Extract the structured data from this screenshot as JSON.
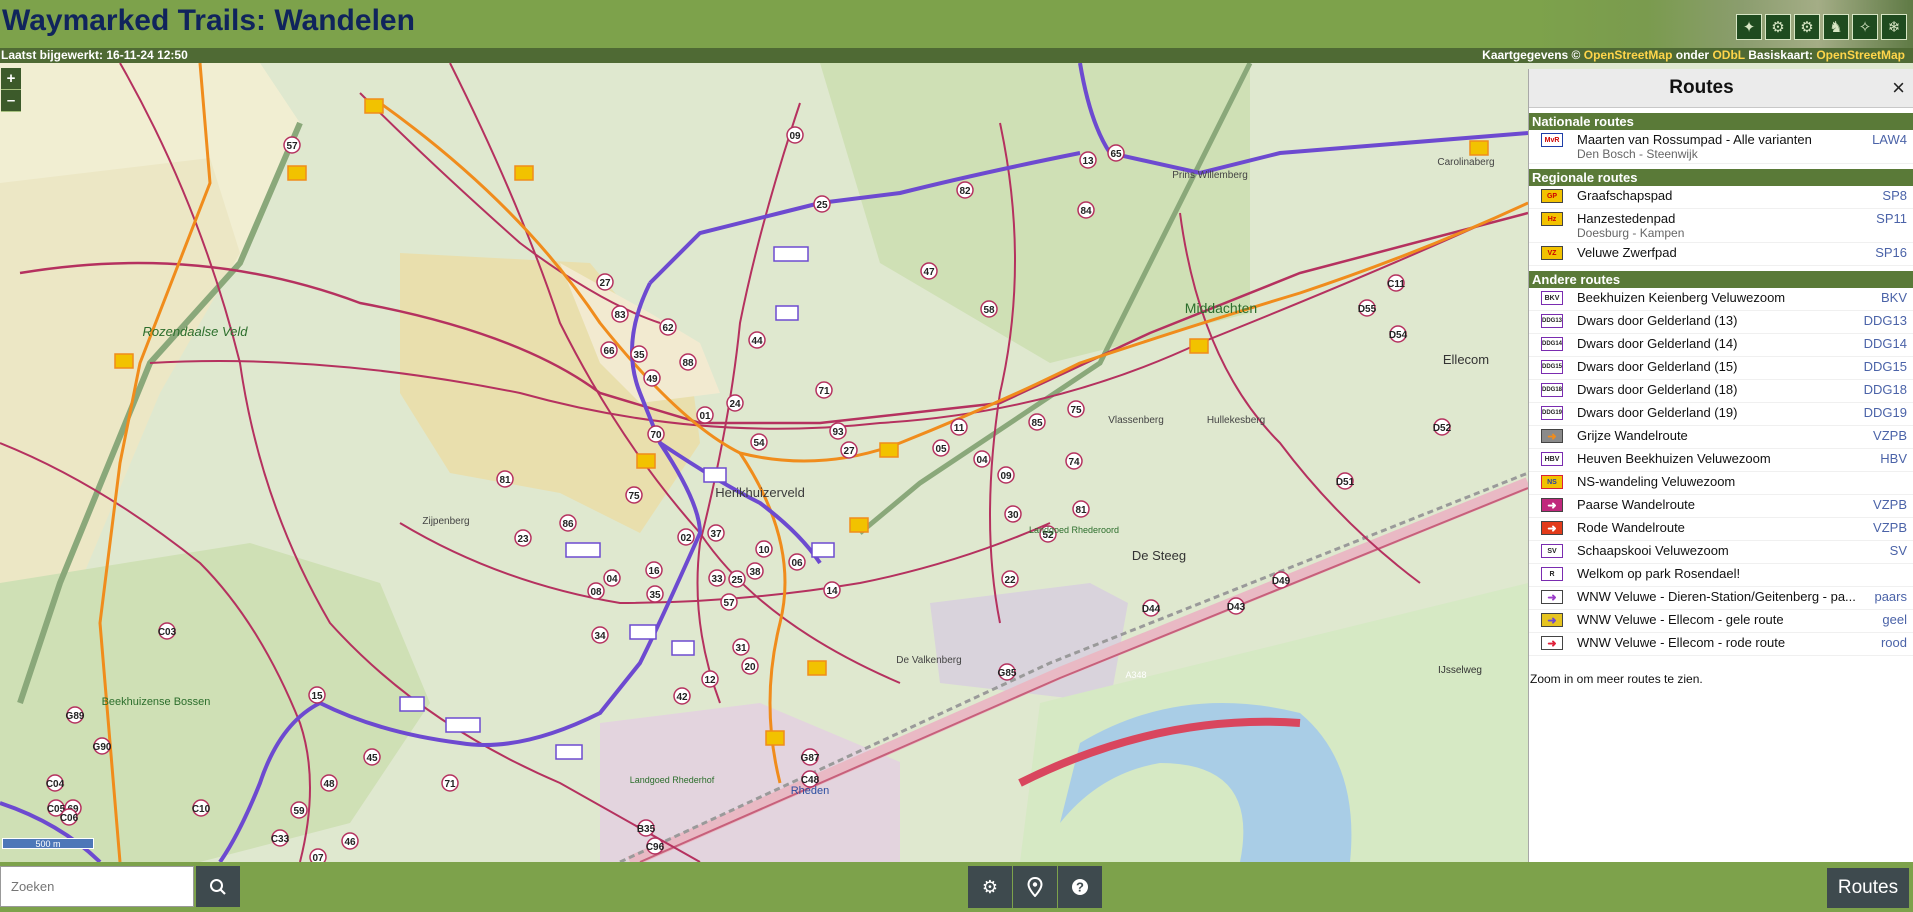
{
  "header": {
    "title": "Waymarked Trails: Wandelen",
    "theme_icons": [
      "hiking-icon",
      "cycling-icon",
      "mtb-icon",
      "riding-icon",
      "skating-icon",
      "slope-icon"
    ]
  },
  "subbar": {
    "last_updated": "Laatst bijgewerkt: 16-11-24 12:50",
    "attrib_prefix": "Kaartgegevens ©",
    "osm_link": "OpenStreetMap",
    "attrib_under": "onder",
    "odbl_link": "ODbL",
    "basemap_label": "Basiskaart:",
    "basemap_link": "OpenStreetMap"
  },
  "map": {
    "zoom_in": "+",
    "zoom_out": "–",
    "scale": "500 m",
    "place_labels": [
      {
        "name": "Rozendaalse Veld"
      },
      {
        "name": "Herikhuizerveld"
      },
      {
        "name": "Middachten"
      },
      {
        "name": "Ellecom"
      },
      {
        "name": "De Steeg"
      },
      {
        "name": "Rheden"
      },
      {
        "name": "Zijpenberg"
      },
      {
        "name": "Beekhuizense Bossen"
      },
      {
        "name": "Carolinaberg"
      },
      {
        "name": "Prins Willemberg"
      },
      {
        "name": "Vlassenberg"
      },
      {
        "name": "Hullekesberg"
      },
      {
        "name": "De Valkenberg"
      },
      {
        "name": "Landgoed Rhederoord"
      },
      {
        "name": "Landgoed Rhederhof"
      },
      {
        "name": "IJsselweg"
      },
      {
        "name": "A348"
      }
    ],
    "nodes": [
      "09",
      "65",
      "13",
      "84",
      "25",
      "82",
      "27",
      "83",
      "62",
      "66",
      "35",
      "49",
      "88",
      "44",
      "24",
      "01",
      "71",
      "47",
      "58",
      "70",
      "54",
      "93",
      "27",
      "05",
      "11",
      "85",
      "75",
      "81",
      "23",
      "86",
      "75",
      "02",
      "37",
      "16",
      "33",
      "25",
      "57",
      "38",
      "10",
      "06",
      "04",
      "35",
      "08",
      "34",
      "31",
      "20",
      "12",
      "42",
      "14",
      "81",
      "52",
      "22",
      "30",
      "09",
      "04",
      "74",
      "15",
      "45",
      "48",
      "71",
      "59",
      "46",
      "07",
      "57",
      "69",
      "G85",
      "G87",
      "C48",
      "B35",
      "C96",
      "C03",
      "C04",
      "C05",
      "C06",
      "C10",
      "C33",
      "G89",
      "G90",
      "D54",
      "D55",
      "D52",
      "D51",
      "D49",
      "D43",
      "D44",
      "C11"
    ]
  },
  "panel": {
    "title": "Routes",
    "close": "×",
    "sections": [
      {
        "heading": "Nationale routes",
        "routes": [
          {
            "symbol": "MvR",
            "name": "Maarten van Rossumpad - Alle varianten",
            "sub": "Den Bosch - Steenwijk",
            "code": "LAW4",
            "symbol_color": "#1f3ea8"
          }
        ]
      },
      {
        "heading": "Regionale routes",
        "routes": [
          {
            "symbol": "GP",
            "name": "Graafschapspad",
            "sub": "",
            "code": "SP8",
            "symbol_color": "#f2c200"
          },
          {
            "symbol": "Hz",
            "name": "Hanzestedenpad",
            "sub": "Doesburg - Kampen",
            "code": "SP11",
            "symbol_color": "#f2c200"
          },
          {
            "symbol": "VZ",
            "name": "Veluwe Zwerfpad",
            "sub": "",
            "code": "SP16",
            "symbol_color": "#f2c200"
          }
        ]
      },
      {
        "heading": "Andere routes",
        "routes": [
          {
            "symbol": "BKV",
            "name": "Beekhuizen Keienberg Veluwezoom",
            "sub": "",
            "code": "BKV",
            "symbol_color": "#7a2cb0"
          },
          {
            "symbol": "DDG13",
            "name": "Dwars door Gelderland (13)",
            "sub": "",
            "code": "DDG13",
            "symbol_color": "#7a2cb0"
          },
          {
            "symbol": "DDG14",
            "name": "Dwars door Gelderland (14)",
            "sub": "",
            "code": "DDG14",
            "symbol_color": "#7a2cb0"
          },
          {
            "symbol": "DDG15",
            "name": "Dwars door Gelderland (15)",
            "sub": "",
            "code": "DDG15",
            "symbol_color": "#7a2cb0"
          },
          {
            "symbol": "DDG18",
            "name": "Dwars door Gelderland (18)",
            "sub": "",
            "code": "DDG18",
            "symbol_color": "#7a2cb0"
          },
          {
            "symbol": "DDG19",
            "name": "Dwars door Gelderland (19)",
            "sub": "",
            "code": "DDG19",
            "symbol_color": "#7a2cb0"
          },
          {
            "symbol": "➜",
            "name": "Grijze Wandelroute",
            "sub": "",
            "code": "VZPB",
            "symbol_color": "#8a8a8a"
          },
          {
            "symbol": "HBV",
            "name": "Heuven Beekhuizen Veluwezoom",
            "sub": "",
            "code": "HBV",
            "symbol_color": "#7a2cb0"
          },
          {
            "symbol": "NS",
            "name": "NS-wandeling Veluwezoom",
            "sub": "",
            "code": "",
            "symbol_color": "#d8213b"
          },
          {
            "symbol": "➜",
            "name": "Paarse Wandelroute",
            "sub": "",
            "code": "VZPB",
            "symbol_color": "#c0287c"
          },
          {
            "symbol": "➜",
            "name": "Rode Wandelroute",
            "sub": "",
            "code": "VZPB",
            "symbol_color": "#e23b1a"
          },
          {
            "symbol": "SV",
            "name": "Schaapskooi Veluwezoom",
            "sub": "",
            "code": "SV",
            "symbol_color": "#7a2cb0"
          },
          {
            "symbol": "R",
            "name": "Welkom op park Rosendael!",
            "sub": "",
            "code": "",
            "symbol_color": "#7a2cb0"
          },
          {
            "symbol": "➜",
            "name": "WNW Veluwe - Dieren-Station/Geitenberg - pa...",
            "sub": "",
            "code": "paars",
            "symbol_color": "#9b3cc9"
          },
          {
            "symbol": "➜",
            "name": "WNW Veluwe - Ellecom - gele route",
            "sub": "",
            "code": "geel",
            "symbol_color": "#e6c420"
          },
          {
            "symbol": "➜",
            "name": "WNW Veluwe - Ellecom - rode route",
            "sub": "",
            "code": "rood",
            "symbol_color": "#e0223a"
          }
        ]
      }
    ],
    "zoom_note": "Zoom in om meer routes te zien."
  },
  "bottom": {
    "search_placeholder": "Zoeken",
    "routes_button": "Routes"
  },
  "colors": {
    "header_green": "#7da24b",
    "subbar_green": "#4f6a34",
    "title_blue": "#10245c",
    "section_green": "#5a7a38",
    "button_dark": "#3e4a4e",
    "route_red": "#b5315f",
    "route_orange": "#f08c1c",
    "route_purple": "#6d4ad0"
  }
}
